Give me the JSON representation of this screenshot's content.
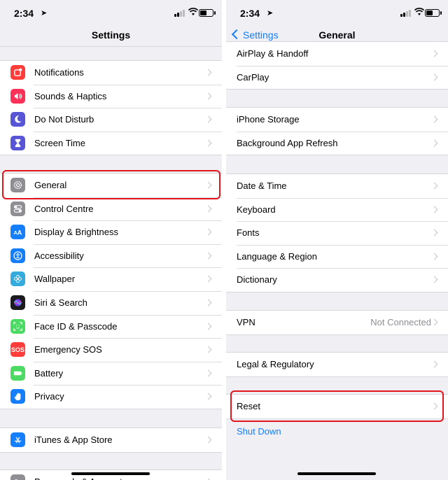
{
  "status": {
    "time": "2:34",
    "location_glyph": "➤"
  },
  "left": {
    "title": "Settings",
    "groups": [
      [
        {
          "label": "Notifications",
          "icon": "notifications-icon",
          "color": "#fc3d39"
        },
        {
          "label": "Sounds & Haptics",
          "icon": "sounds-icon",
          "color": "#fc3158"
        },
        {
          "label": "Do Not Disturb",
          "icon": "moon-icon",
          "color": "#5856d6"
        },
        {
          "label": "Screen Time",
          "icon": "hourglass-icon",
          "color": "#5856d6"
        }
      ],
      [
        {
          "label": "General",
          "icon": "gear-icon",
          "color": "#8e8e93"
        },
        {
          "label": "Control Centre",
          "icon": "toggles-icon",
          "color": "#8e8e93"
        },
        {
          "label": "Display & Brightness",
          "icon": "text-size-icon",
          "color": "#147efb"
        },
        {
          "label": "Accessibility",
          "icon": "accessibility-icon",
          "color": "#147efb"
        },
        {
          "label": "Wallpaper",
          "icon": "flower-icon",
          "color": "#35aadc"
        },
        {
          "label": "Siri & Search",
          "icon": "siri-icon",
          "color": "#1c1c1e"
        },
        {
          "label": "Face ID & Passcode",
          "icon": "face-id-icon",
          "color": "#4cd964"
        },
        {
          "label": "Emergency SOS",
          "icon": "sos-icon",
          "color": "#fc3d39",
          "icon_text": "SOS"
        },
        {
          "label": "Battery",
          "icon": "battery-icon",
          "color": "#4cd964"
        },
        {
          "label": "Privacy",
          "icon": "hand-icon",
          "color": "#147efb"
        }
      ],
      [
        {
          "label": "iTunes & App Store",
          "icon": "app-store-icon",
          "color": "#147efb"
        }
      ],
      [
        {
          "label": "Passwords & Accounts",
          "icon": "key-icon",
          "color": "#8e8e93"
        }
      ]
    ]
  },
  "right": {
    "title": "General",
    "back_label": "Settings",
    "groups": [
      [
        {
          "label": "AirPlay & Handoff"
        },
        {
          "label": "CarPlay"
        }
      ],
      [
        {
          "label": "iPhone Storage"
        },
        {
          "label": "Background App Refresh"
        }
      ],
      [
        {
          "label": "Date & Time"
        },
        {
          "label": "Keyboard"
        },
        {
          "label": "Fonts"
        },
        {
          "label": "Language & Region"
        },
        {
          "label": "Dictionary"
        }
      ],
      [
        {
          "label": "VPN",
          "detail": "Not Connected"
        }
      ],
      [
        {
          "label": "Legal & Regulatory"
        }
      ],
      [
        {
          "label": "Reset"
        }
      ]
    ],
    "shutdown_label": "Shut Down"
  }
}
